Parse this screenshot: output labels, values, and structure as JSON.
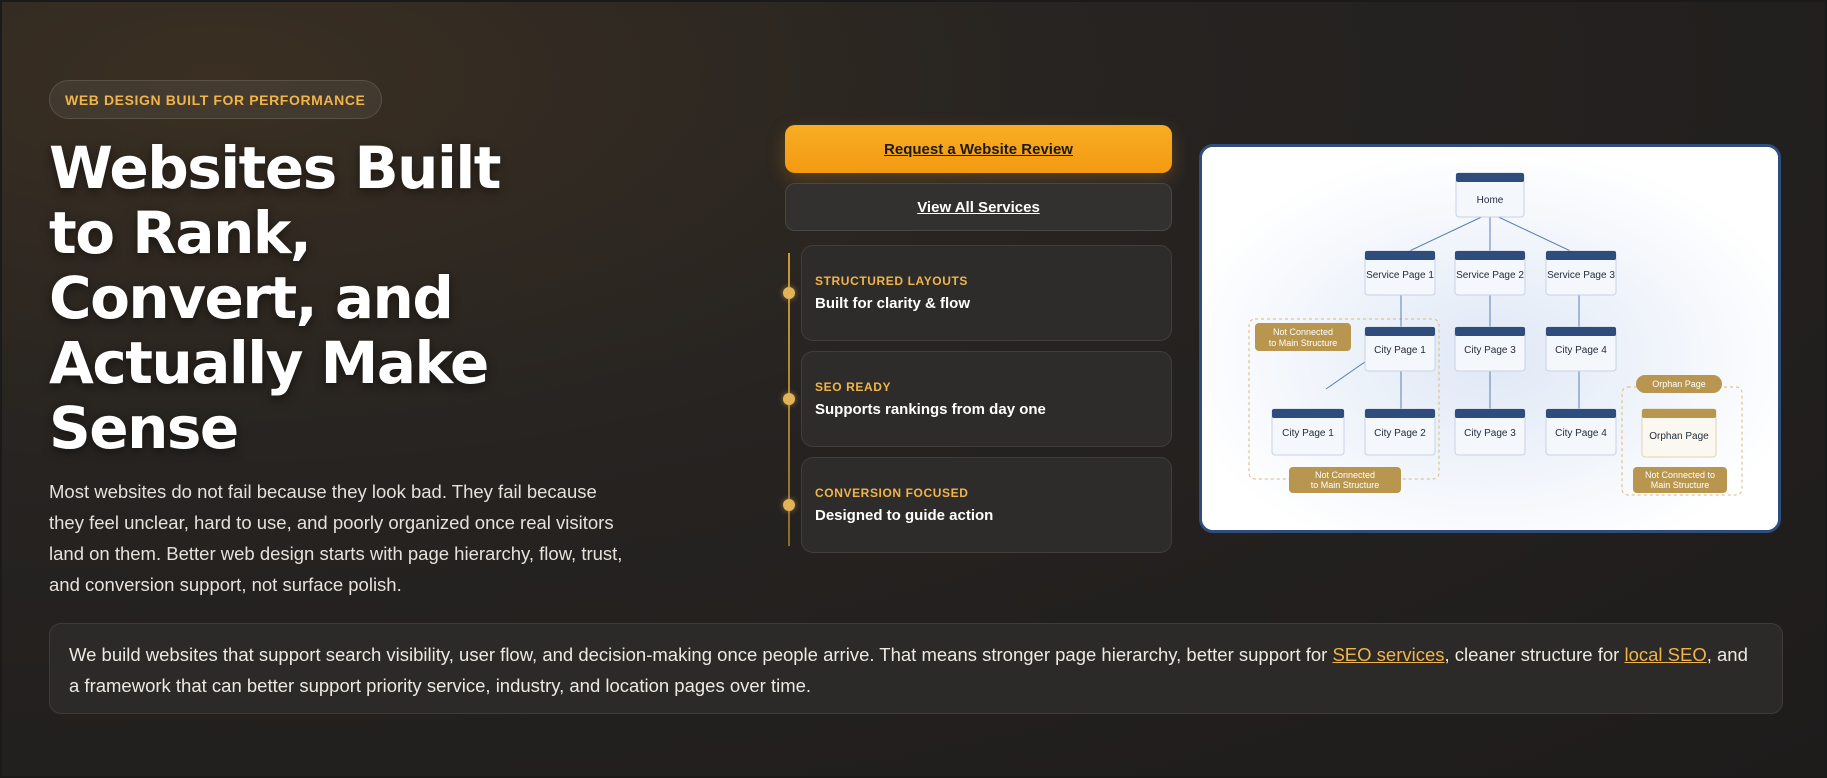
{
  "hero": {
    "eyebrow": "WEB DESIGN BUILT FOR PERFORMANCE",
    "title_lines": [
      "Websites Built",
      "to Rank,",
      "Convert, and",
      "Actually Make",
      "Sense"
    ],
    "description": "Most websites do not fail because they look bad. They fail because they feel unclear, hard to use, and poorly organized once real visitors land on them. Better web design starts with page hierarchy, flow, trust, and conversion support, not surface polish."
  },
  "actions": {
    "primary_label": "Request a Website Review",
    "secondary_label": "View All Services"
  },
  "features": [
    {
      "kicker": "STRUCTURED LAYOUTS",
      "text": "Built for clarity & flow"
    },
    {
      "kicker": "SEO READY",
      "text": "Supports rankings from day one"
    },
    {
      "kicker": "CONVERSION FOCUSED",
      "text": "Designed to guide action"
    }
  ],
  "diagram": {
    "home": "Home",
    "services": [
      "Service Page 1",
      "Service Page 2",
      "Service Page 3"
    ],
    "city_row1": [
      "City Page 1",
      "City Page 3",
      "City Page 4"
    ],
    "city_row2": [
      "City Page 1",
      "City Page 2",
      "City Page 3",
      "City Page 4"
    ],
    "orphan_tag": "Orphan Page",
    "orphan_node": "Orphan Page",
    "not_connected_1": [
      "Not Connected",
      "to Main Structure"
    ],
    "not_connected_2": [
      "Not Connected",
      "to Main Structure"
    ],
    "not_connected_3": [
      "Not Connected to",
      "Main Structure"
    ]
  },
  "bottom": {
    "text_before": "We build websites that support search visibility, user flow, and decision-making once people arrive. That means stronger page hierarchy, better support for ",
    "link1": "SEO services",
    "text_middle": ", cleaner structure for ",
    "link2": "local SEO",
    "text_after": ", and a framework that can better support priority service, industry, and location pages over time."
  },
  "colors": {
    "accent": "#f0b44a",
    "primary_button": "#f5a51b",
    "node_header": "#2e4d7c",
    "tag_gold": "#b8964f"
  }
}
